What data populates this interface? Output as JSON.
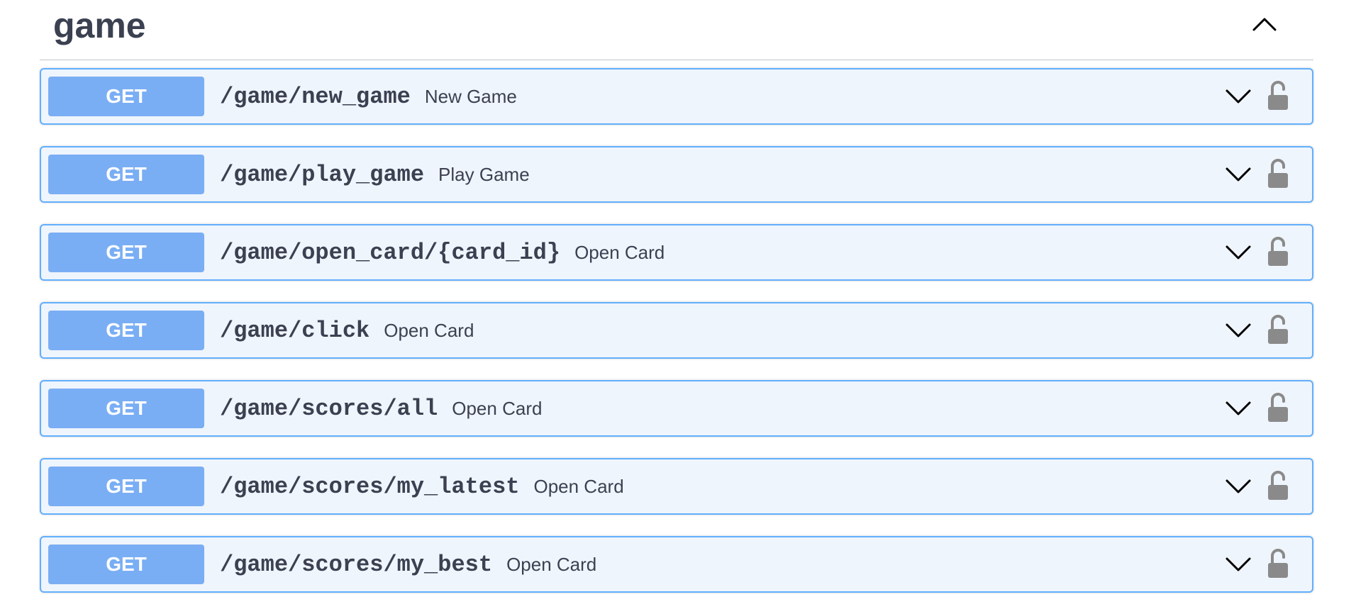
{
  "section": {
    "title": "game",
    "toggle_icon": "chevron-up-icon"
  },
  "operations": [
    {
      "method": "GET",
      "path": "/game/new_game",
      "summary": "New Game"
    },
    {
      "method": "GET",
      "path": "/game/play_game",
      "summary": "Play Game"
    },
    {
      "method": "GET",
      "path": "/game/open_card/{card_id}",
      "summary": "Open Card"
    },
    {
      "method": "GET",
      "path": "/game/click",
      "summary": "Open Card"
    },
    {
      "method": "GET",
      "path": "/game/scores/all",
      "summary": "Open Card"
    },
    {
      "method": "GET",
      "path": "/game/scores/my_latest",
      "summary": "Open Card"
    },
    {
      "method": "GET",
      "path": "/game/scores/my_best",
      "summary": "Open Card"
    }
  ],
  "icons": {
    "expand": "chevron-down-icon",
    "auth": "unlocked-padlock-icon"
  },
  "colors": {
    "get_accent": "#61affe",
    "get_badge": "#7aaef4",
    "row_background": "#eff5fc",
    "text": "#3b4151",
    "lock": "#8a8a8a"
  }
}
